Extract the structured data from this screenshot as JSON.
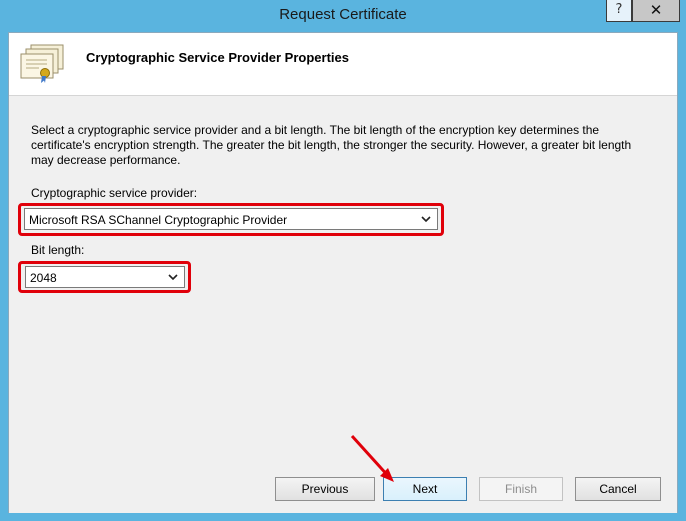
{
  "window": {
    "title": "Request Certificate",
    "help_glyph": "?",
    "close_glyph": "✕"
  },
  "header": {
    "icon": "certificate-stack-icon",
    "title": "Cryptographic Service Provider Properties"
  },
  "main": {
    "description": "Select a cryptographic service provider and a bit length. The bit length of the encryption key determines the certificate's encryption strength. The greater the bit length, the stronger the security. However, a greater bit length may decrease performance.",
    "provider_label": "Cryptographic service provider:",
    "provider_value": "Microsoft RSA SChannel Cryptographic Provider",
    "bitlength_label": "Bit length:",
    "bitlength_value": "2048"
  },
  "buttons": {
    "previous": "Previous",
    "next": "Next",
    "finish": "Finish",
    "cancel": "Cancel"
  },
  "colors": {
    "highlight": "#e0000a",
    "window_frame": "#5ab4df"
  }
}
